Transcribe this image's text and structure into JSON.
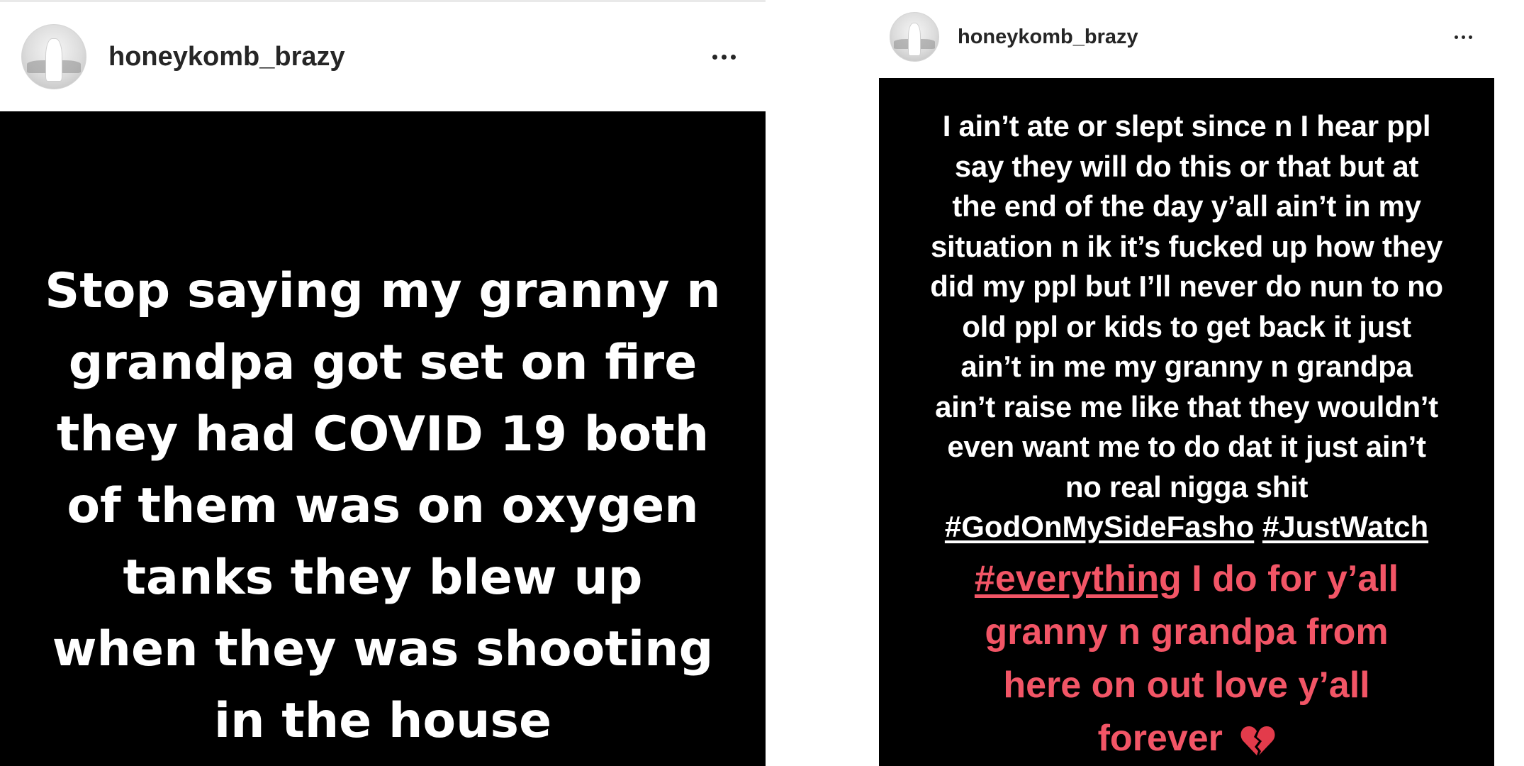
{
  "left_post": {
    "username": "honeykomb_brazy",
    "story_text": "Stop saying my granny n grandpa got set on fire they had COVID 19 both of them was on oxygen tanks they blew up when they was shooting in the house"
  },
  "right_post": {
    "username": "honeykomb_brazy",
    "story_text": "I ain’t ate or slept since n I hear ppl\nsay they will do this or that but at\nthe end of the day y’all ain’t in my\nsituation n ik it’s fucked up how they\ndid my ppl but I’ll never do nun to no\nold ppl or kids to get back it just\nain’t in me my granny n grandpa\nain’t raise me like that they wouldn’t\neven want me to  do dat it just ain’t\nno real nigga shit",
    "hashtags": [
      "#GodOnMySideFasho",
      "#JustWatch"
    ],
    "red_hashtag": "#everything",
    "red_text_1": " I do for y’all",
    "red_text_2": "granny n grandpa from",
    "red_text_3": "here on out love y’all",
    "red_text_4": "forever",
    "emoji_icon": "broken-heart-icon",
    "accent_color": "#f25566"
  },
  "colors": {
    "story_background": "#000000",
    "story_text": "#ffffff",
    "username": "#262626"
  }
}
